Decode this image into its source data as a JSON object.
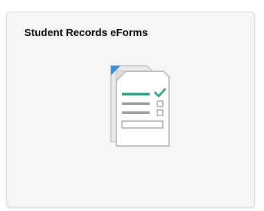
{
  "tile": {
    "title": "Student Records eForms",
    "icon": "eforms-document-checklist-icon"
  },
  "colors": {
    "tile_background": "#f6f6f6",
    "tile_border": "#d9d9d9",
    "icon_accent": "#2aa58a",
    "icon_fold": "#3b8fd4",
    "icon_lines": "#9e9e9e"
  }
}
